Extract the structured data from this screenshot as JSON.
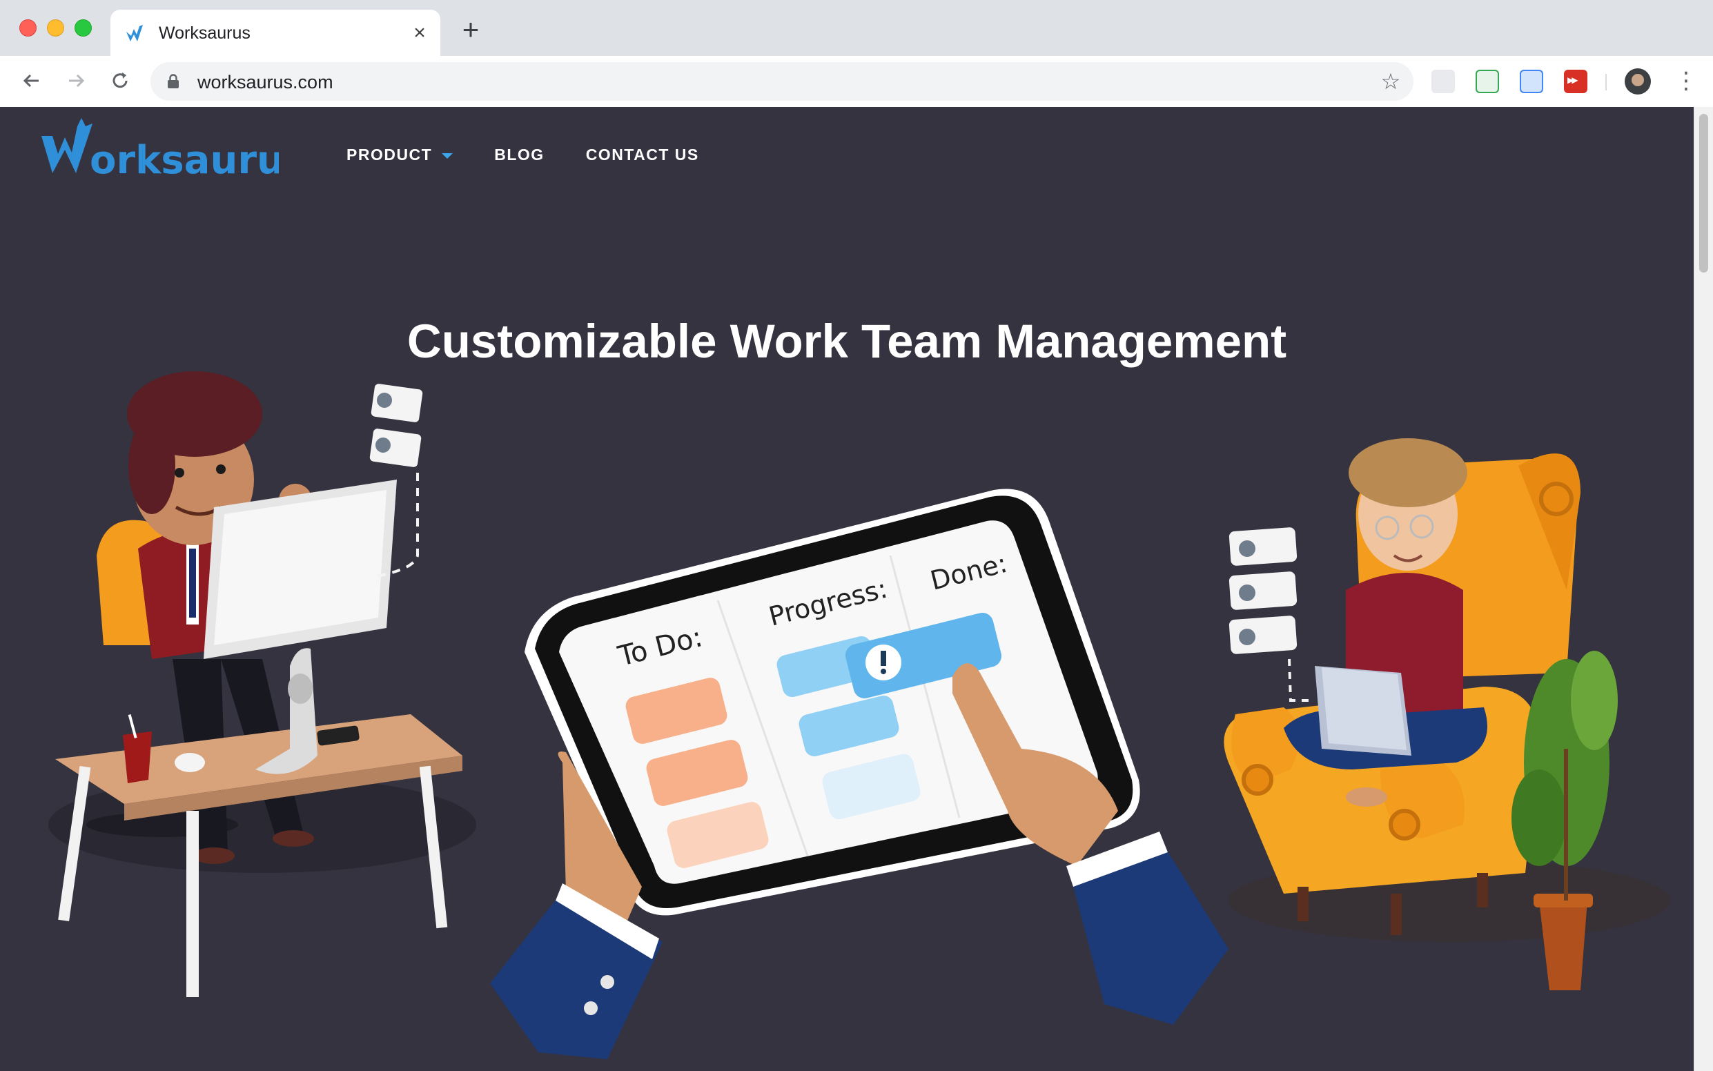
{
  "browser": {
    "tab": {
      "title": "Worksaurus",
      "favicon": "worksaurus-favicon-icon",
      "close": "×"
    },
    "new_tab": "+",
    "toolbar": {
      "back": "back-arrow-icon",
      "forward": "forward-arrow-icon",
      "reload": "reload-icon",
      "url": "worksaurus.com",
      "star": "bookmark-star-icon"
    },
    "extensions": [
      "extension-icon",
      "sheets-extension-icon",
      "screenshot-extension-icon",
      "media-extension-icon"
    ]
  },
  "site": {
    "logo_text": "Worksaurus",
    "nav": {
      "product": "PRODUCT",
      "blog": "BLOG",
      "contact": "CONTACT US"
    },
    "hero": {
      "headline": "Customizable Work Team Management",
      "board": {
        "todo": "To Do:",
        "progress": "Progress:",
        "done": "Done:"
      }
    }
  },
  "colors": {
    "page_bg": "#34333f",
    "accent_blue": "#3da6e8",
    "logo_blue": "#2f8fd8",
    "todo_card": "#f7b08a",
    "progress_card": "#7cc7f2"
  }
}
